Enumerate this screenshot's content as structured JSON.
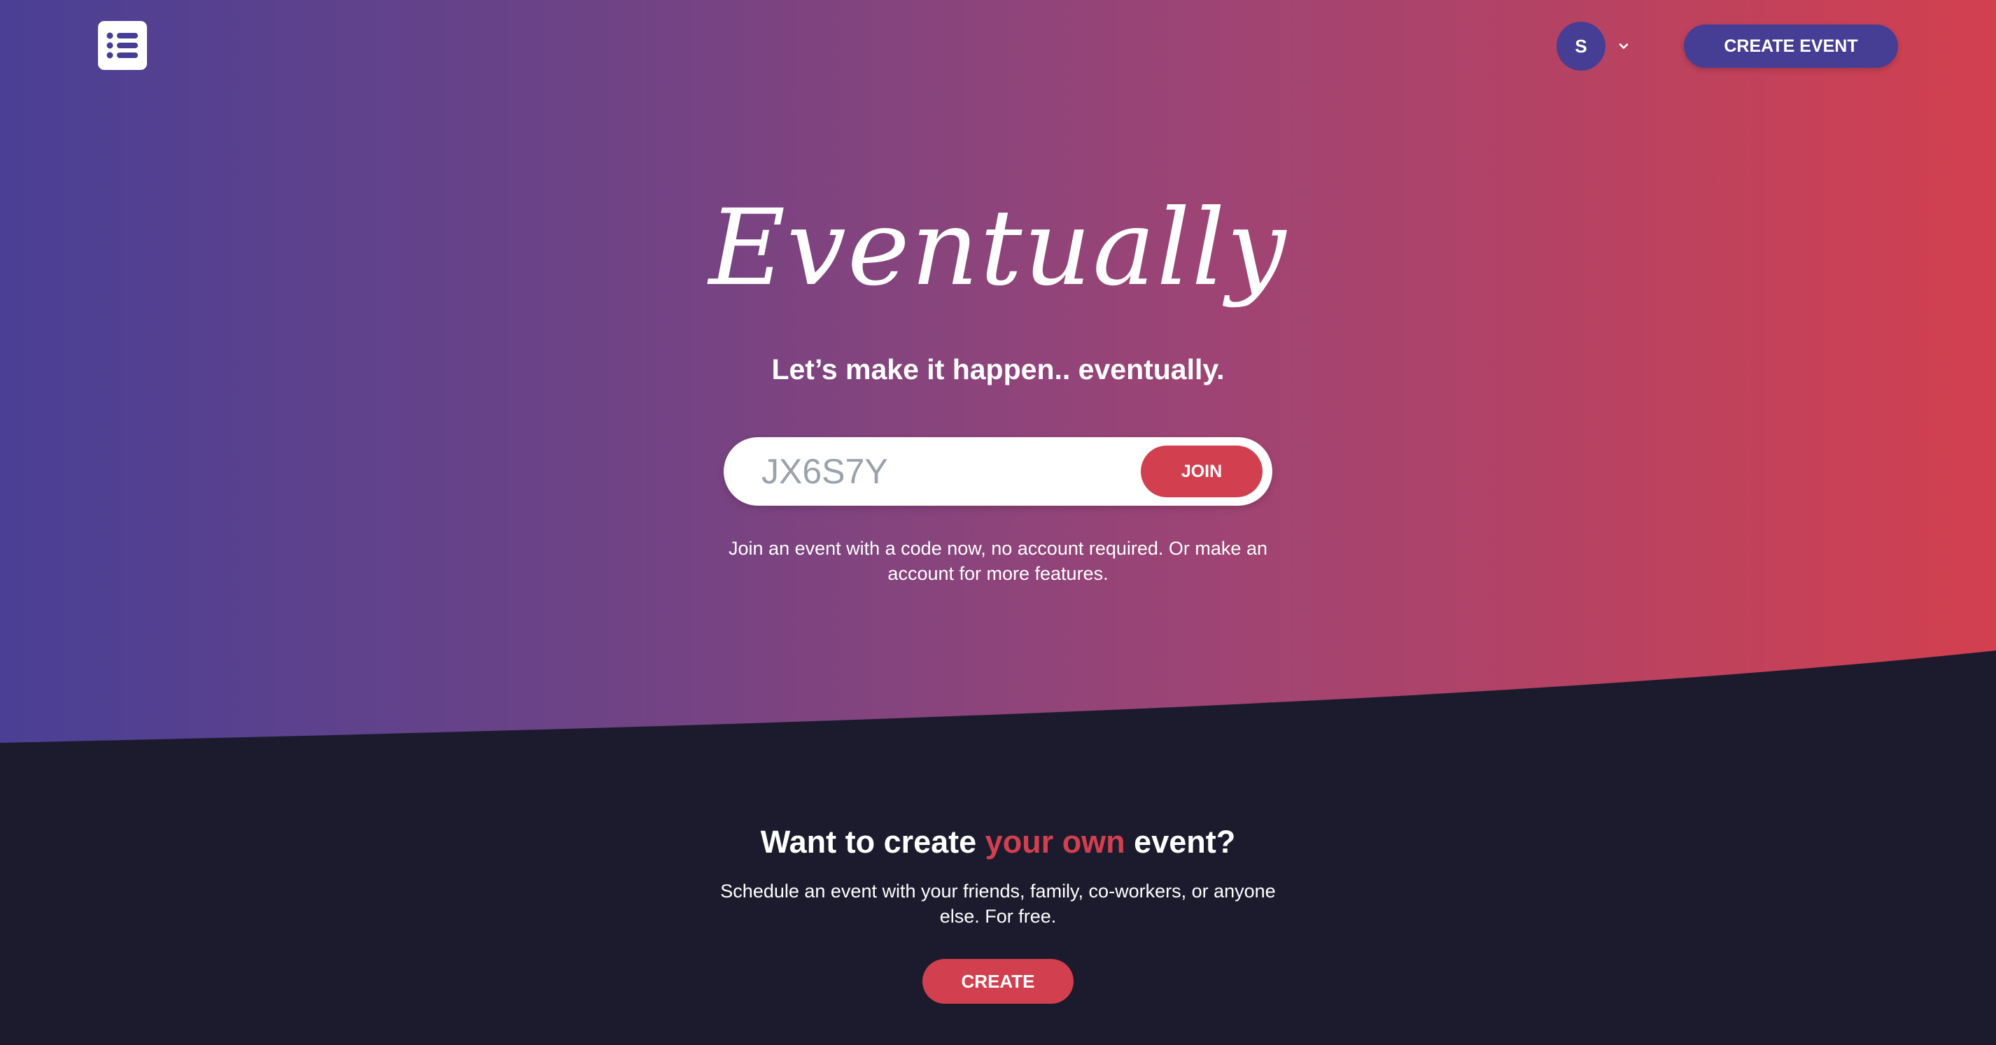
{
  "header": {
    "avatar_initial": "S",
    "create_event_label": "CREATE EVENT"
  },
  "hero": {
    "brand": "Eventually",
    "tagline": "Let’s make it happen.. eventually.",
    "join": {
      "placeholder": "JX6S7Y",
      "button_label": "JOIN"
    },
    "note": "Join an event with a code now, no account required. Or make an account for more features."
  },
  "cta": {
    "title_before": "Want to create ",
    "title_accent": "your own",
    "title_after": " event?",
    "description": "Schedule an event with your friends, family, co-workers, or anyone else. For free.",
    "button_label": "CREATE"
  },
  "colors": {
    "primary": "#463e94",
    "accent": "#d2404f",
    "dark": "#1c1b2d",
    "gradient_start": "#4a3f95",
    "gradient_end": "#d2404f"
  },
  "icons": {
    "logo": "list-icon",
    "avatar_menu": "chevron-down-icon"
  }
}
